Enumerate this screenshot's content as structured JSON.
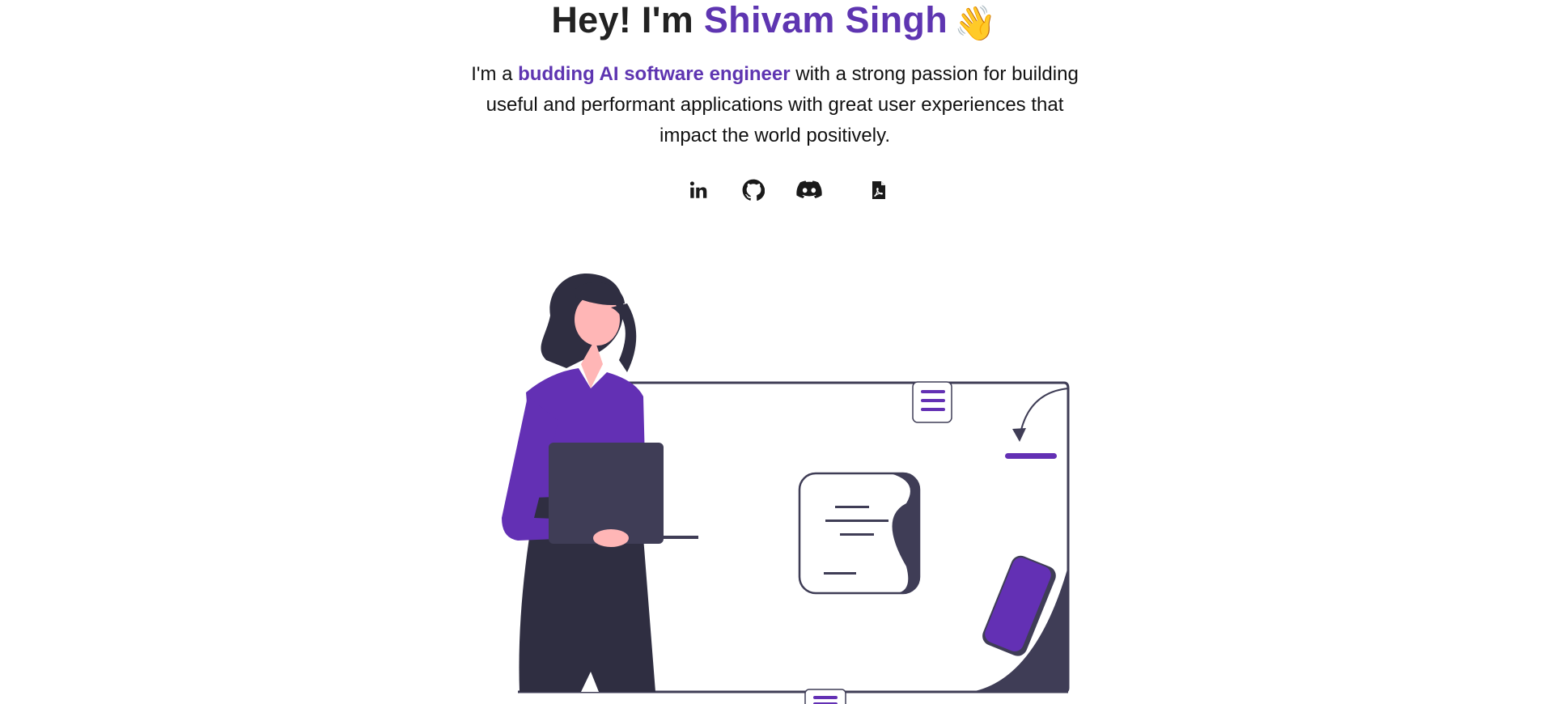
{
  "hero": {
    "greeting": "Hey! I'm",
    "name": "Shivam Singh",
    "wave_emoji": "👋",
    "intro_prefix": "I'm a",
    "intro_highlight": "budding AI software engineer",
    "intro_suffix": "with a strong passion for building useful and performant applications with great user experiences that impact the world positively."
  },
  "socials": [
    {
      "icon": "linkedin-icon"
    },
    {
      "icon": "github-icon"
    },
    {
      "icon": "discord-icon"
    },
    {
      "icon": "pdf-resume-icon"
    }
  ],
  "colors": {
    "accent": "#5e35b1",
    "illustration_purple": "#6330b4",
    "illustration_dark": "#2f2e41",
    "skin": "#ffb6b6"
  }
}
